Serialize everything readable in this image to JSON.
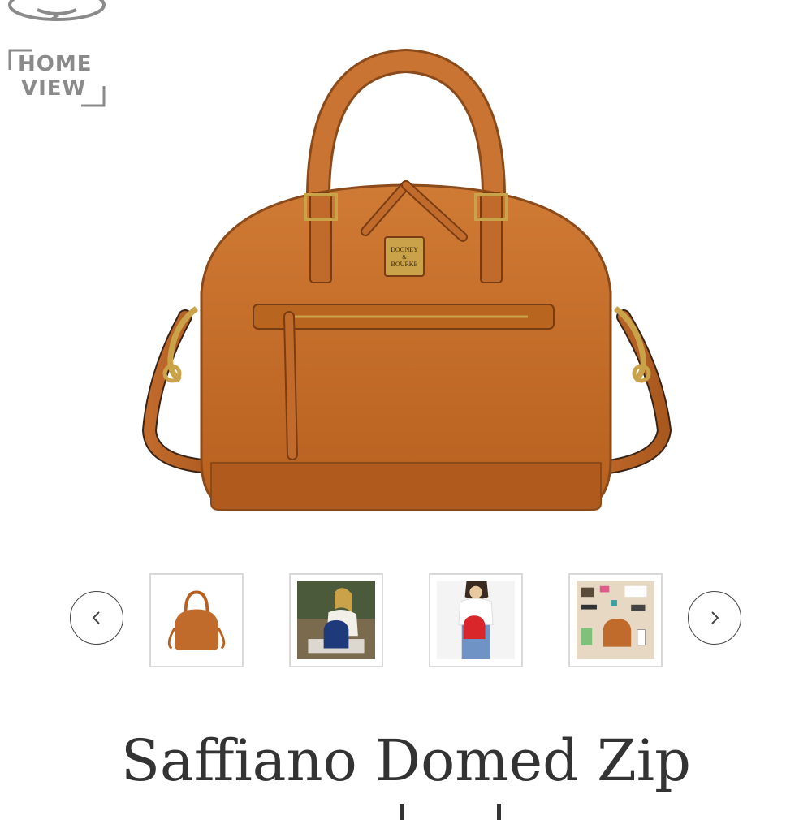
{
  "header": {
    "home_view_line1": "HOME",
    "home_view_line2": "VIEW"
  },
  "product": {
    "brand_plate_line1": "DOONEY",
    "brand_plate_line2": "&",
    "brand_plate_line3": "BOURKE",
    "title": "Saffiano Domed Zip"
  },
  "carousel": {
    "prev_icon": "chevron-left-icon",
    "next_icon": "chevron-right-icon",
    "thumbnails": [
      {
        "name": "thumbnail-tan-satchel"
      },
      {
        "name": "thumbnail-woman-navy-bag"
      },
      {
        "name": "thumbnail-woman-red-bag"
      },
      {
        "name": "thumbnail-flatlay-contents"
      }
    ]
  },
  "colors": {
    "leather": "#C06A2C",
    "leather_dark": "#9A4E1C",
    "hardware": "#C9A24A",
    "navy": "#1F3A7A",
    "red": "#D8262A"
  }
}
